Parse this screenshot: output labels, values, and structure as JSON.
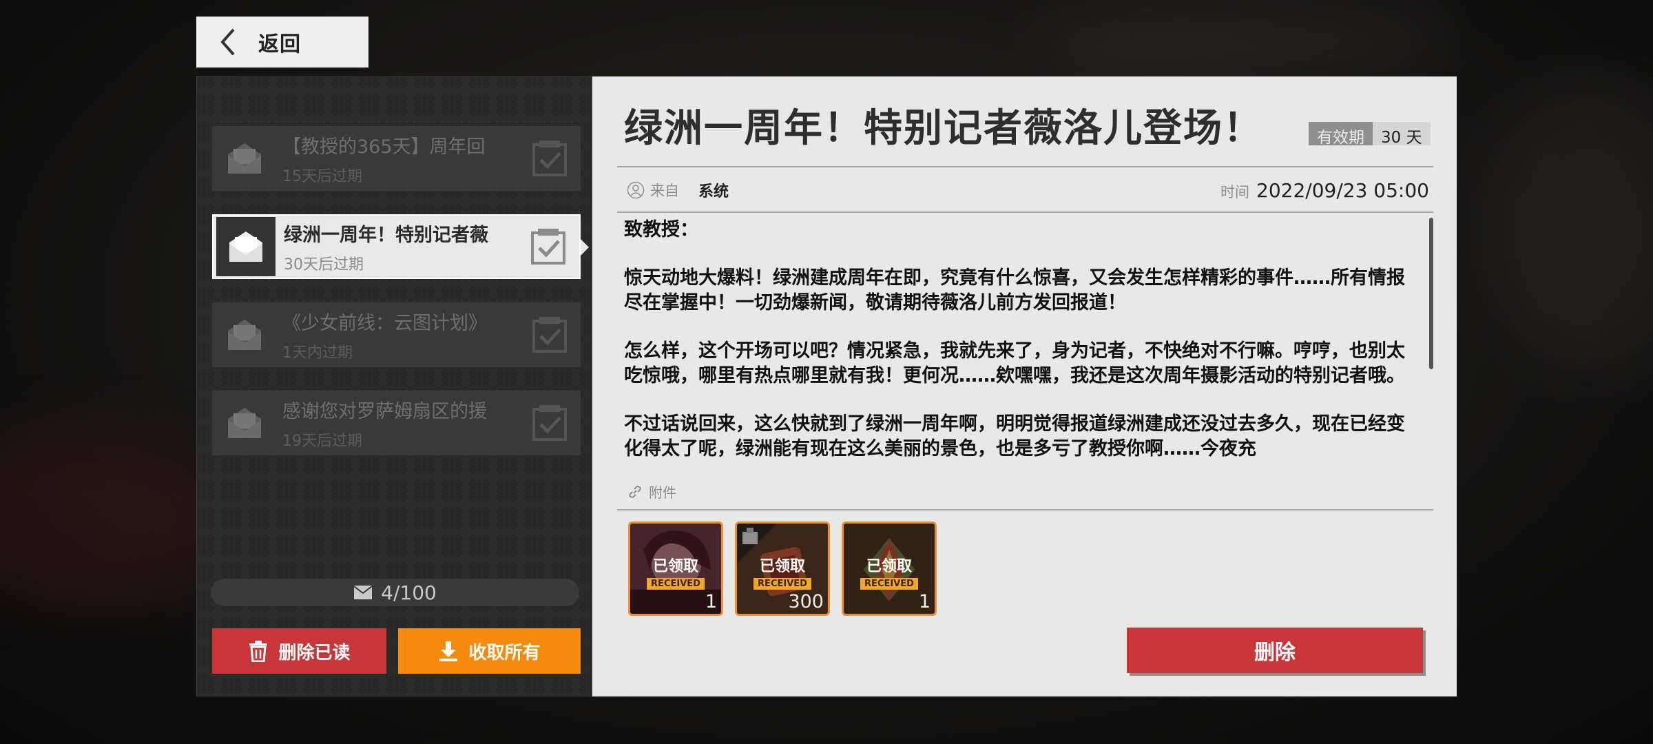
{
  "back": {
    "label": "返回"
  },
  "mail_list": [
    {
      "title": "【教授的365天】周年回",
      "expiry": "15天后过期",
      "selected": false
    },
    {
      "title": "绿洲一周年！特别记者薇",
      "expiry": "30天后过期",
      "selected": true
    },
    {
      "title": "《少女前线：云图计划》",
      "expiry": "1天内过期",
      "selected": false
    },
    {
      "title": "感谢您对罗萨姆扇区的援",
      "expiry": "19天后过期",
      "selected": false
    }
  ],
  "mail_count": "4/100",
  "buttons": {
    "delete_read": "删除已读",
    "collect_all": "收取所有",
    "delete": "删除"
  },
  "detail": {
    "title": "绿洲一周年！特别记者薇洛儿登场！",
    "validity_label": "有效期",
    "validity_value": "30 天",
    "from_label": "来自",
    "from_value": "系统",
    "time_label": "时间",
    "time_value": "2022/09/23 05:00",
    "body": [
      "致教授：",
      "惊天动地大爆料！绿洲建成周年在即，究竟有什么惊喜，又会发生怎样精彩的事件……所有情报尽在掌握中！一切劲爆新闻，敬请期待薇洛儿前方发回报道！",
      "怎么样，这个开场可以吧？情况紧急，我就先来了，身为记者，不快绝对不行嘛。哼哼，也别太吃惊哦，哪里有热点哪里就有我！更何况……欸嘿嘿，我还是这次周年摄影活动的特别记者哦。",
      "不过话说回来，这么快就到了绿洲一周年啊，明明觉得报道绿洲建成还没过去多久，现在已经变化得太了呢，绿洲能有现在这么美丽的景色，也是多亏了教授你啊……今夜充"
    ],
    "attachment_label": "附件",
    "attachments": [
      {
        "status_cn": "已领取",
        "status_en": "RECEIVED",
        "qty": "1",
        "icon": "character-portrait"
      },
      {
        "status_cn": "已领取",
        "status_en": "RECEIVED",
        "qty": "300",
        "icon": "material-pack"
      },
      {
        "status_cn": "已领取",
        "status_en": "RECEIVED",
        "qty": "1",
        "icon": "crystal-shard"
      }
    ]
  },
  "colors": {
    "accent_red": "#c8363a",
    "accent_orange": "#f58a0c",
    "item_border": "#f0902a",
    "received_tag": "#f5a623"
  }
}
